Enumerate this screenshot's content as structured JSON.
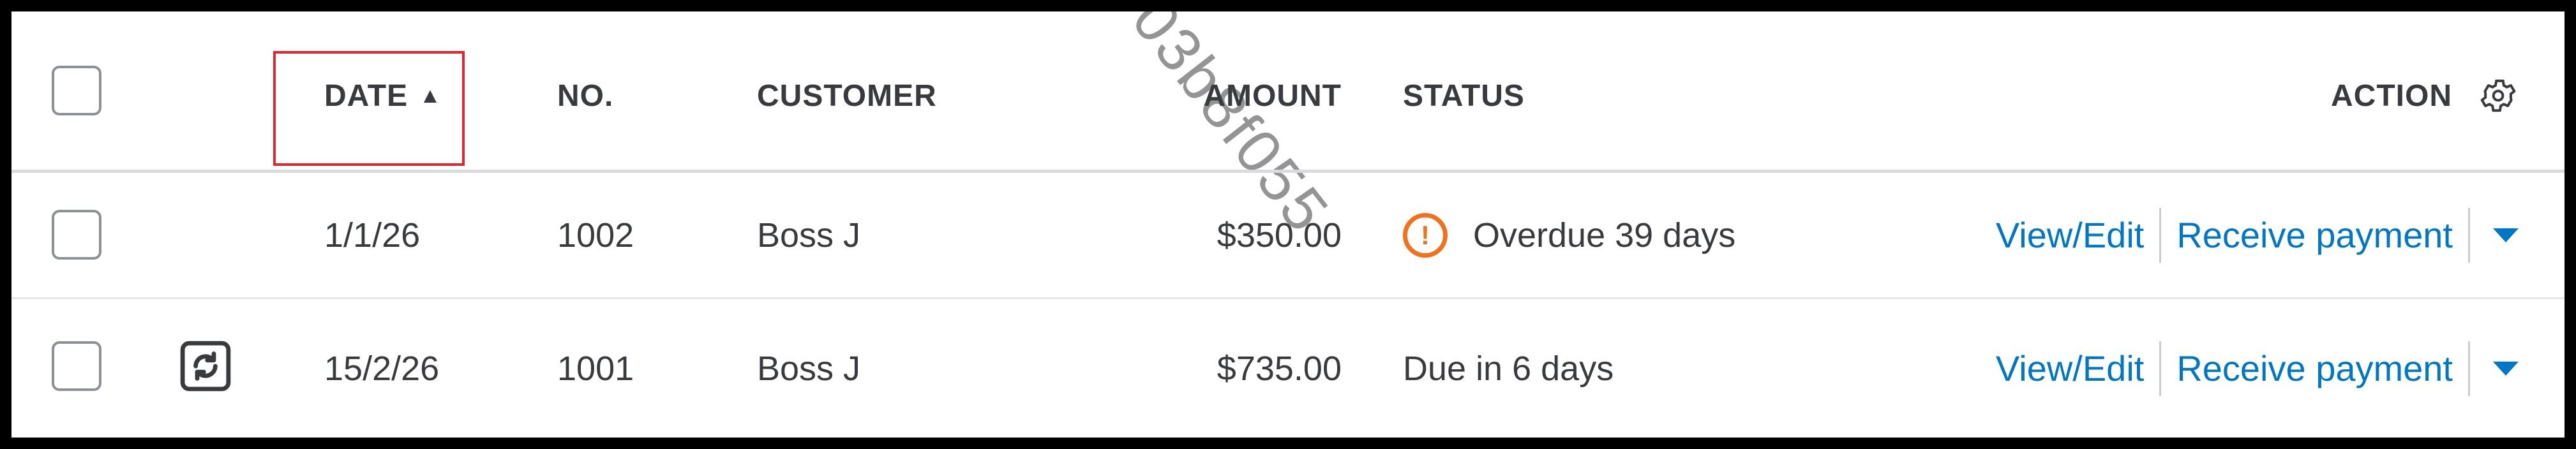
{
  "table": {
    "headers": {
      "date": "DATE",
      "sort_indicator": "▲",
      "no": "NO.",
      "customer": "CUSTOMER",
      "amount": "AMOUNT",
      "status": "STATUS",
      "action": "ACTION"
    },
    "rows": [
      {
        "recurring": false,
        "date": "1/1/26",
        "no": "1002",
        "customer": "Boss J",
        "amount": "$350.00",
        "status": "Overdue 39 days",
        "status_icon": "exclamation-circle-icon",
        "primary_action": "View/Edit",
        "secondary_action": "Receive payment"
      },
      {
        "recurring": true,
        "date": "15/2/26",
        "no": "1001",
        "customer": "Boss J",
        "amount": "$735.00",
        "status": "Due in 6 days",
        "status_icon": "",
        "primary_action": "View/Edit",
        "secondary_action": "Receive payment"
      }
    ]
  },
  "watermark": "03b8f055",
  "colors": {
    "link": "#0077c5",
    "overdue": "#f2711c",
    "highlight_box": "#e0252e",
    "text": "#393a3d"
  }
}
